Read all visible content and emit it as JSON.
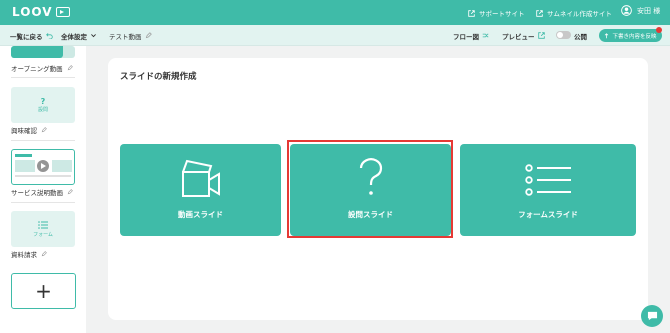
{
  "header": {
    "logo_text": "LOOV",
    "support_link": "サポートサイト",
    "thumbnail_link": "サムネイル作成サイト",
    "user_name": "安田 様"
  },
  "toolbar": {
    "back_label": "一覧に戻る",
    "settings_label": "全体設定",
    "video_name": "テスト動画",
    "flow_label": "フロー図",
    "preview_label": "プレビュー",
    "public_label": "公開",
    "public_toggle_on": false,
    "reflect_button_label": "下書き内容を反映"
  },
  "sidebar": {
    "slides": [
      {
        "label": "オープニング動画"
      },
      {
        "label": "興味確認",
        "thumb_symbol": "?",
        "thumb_text": "設問"
      },
      {
        "label": "サービス説明動画"
      },
      {
        "label": "資料請求",
        "thumb_text": "フォーム"
      }
    ],
    "add_symbol": "+"
  },
  "main": {
    "title": "スライドの新規作成",
    "options": [
      {
        "label": "動画スライド",
        "icon": "video-camera-icon"
      },
      {
        "label": "設問スライド",
        "icon": "question-mark-icon",
        "selected": true
      },
      {
        "label": "フォームスライド",
        "icon": "list-icon"
      }
    ]
  },
  "colors": {
    "accent": "#3fbba8",
    "highlight": "#e53935",
    "subbar": "#e2f3f0"
  }
}
